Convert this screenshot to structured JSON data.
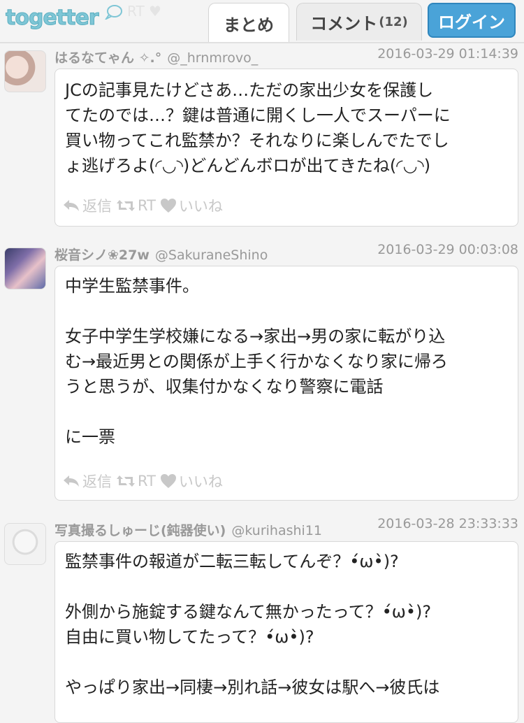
{
  "header": {
    "logo": "togetter",
    "faded_text": "RT ♥",
    "tabs": [
      {
        "label": "まとめ"
      },
      {
        "label": "コメント",
        "count": "(12)"
      }
    ],
    "login_label": "ログイン"
  },
  "tweets": [
    {
      "name": "はるなてゃん ✧.°",
      "handle": "@_hrnmrovo_",
      "date": "2016-03-29 01:14:39",
      "text": "JCの記事見たけどさあ…ただの家出少女を保護し\nてたのでは…？鍵は普通に開くし一人でスーパーに\n買い物ってこれ監禁か？それなりに楽しんでたでし\nょ逃げろよ(◜◡◝)どんどんボロが出てきたね(◜◡◝)",
      "reply": "返信",
      "rt": "RT",
      "like": "いいね"
    },
    {
      "name": "桜音シノ❀27w",
      "handle": "@SakuraneShino",
      "date": "2016-03-29 00:03:08",
      "text": "中学生監禁事件。\n\n女子中学生学校嫌になる→家出→男の家に転がり込\nむ→最近男との関係が上手く行かなくなり家に帰ろ\nうと思うが、収集付かなくなり警察に電話\n\nに一票",
      "reply": "返信",
      "rt": "RT",
      "like": "いいね"
    },
    {
      "name": "写真撮るしゅーじ(鈍器使い)",
      "handle": "@kurihashi11",
      "date": "2016-03-28 23:33:33",
      "text": "監禁事件の報道が二転三転してんぞ？•́ω•̀)?\n\n外側から施錠する鍵なんて無かったって？•́ω•̀)?\n自由に買い物してたって？•́ω•̀)?\n\nやっぱり家出→同棲→別れ話→彼女は駅へ→彼氏は"
    }
  ],
  "colors": {
    "logo": "#7fc6d6",
    "login_bg": "#4aa3d8",
    "meta_text": "#999999",
    "action_icon": "#c8c8c8"
  }
}
